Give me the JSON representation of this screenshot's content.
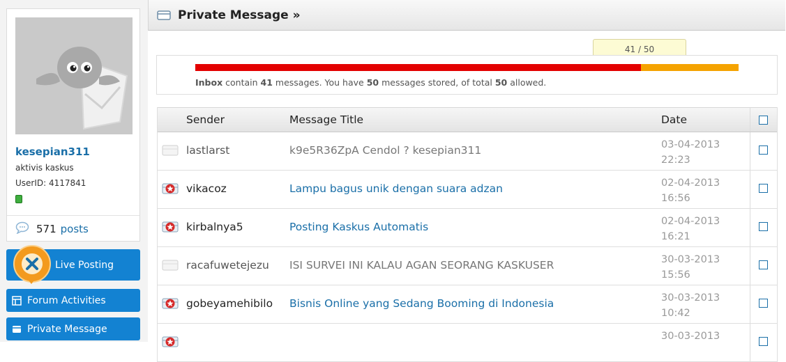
{
  "profile": {
    "username": "kesepian311",
    "title": "aktivis kaskus",
    "user_id": "UserID: 4117841",
    "post_count": "571",
    "post_label": "posts",
    "status": "online"
  },
  "sidebar": {
    "items": [
      {
        "label": "Live Posting",
        "icon": "live-posting-icon"
      },
      {
        "label": "Forum Activities",
        "icon": "forum-activities-icon"
      },
      {
        "label": "Private Message",
        "icon": "envelope-icon"
      }
    ]
  },
  "header": {
    "title": "Private Message »",
    "icon": "envelope-icon"
  },
  "quota": {
    "tooltip": "41 / 50",
    "used": 41,
    "total": 50,
    "text_folder": "Inbox",
    "text_1": " contain ",
    "inbox_count": "41",
    "text_2": " messages. You have ",
    "stored_count": "50",
    "text_3": " messages stored, of total ",
    "allowed_count": "50",
    "text_4": " allowed.",
    "used_color": "#e30000",
    "remaining_color": "#f5a300"
  },
  "table": {
    "headers": {
      "sender": "Sender",
      "title": "Message Title",
      "date": "Date"
    },
    "rows": [
      {
        "sender": "lastlarst",
        "title": "k9e5R36ZpA Cendol ? kesepian311",
        "date": "03-04-2013",
        "time": "22:23",
        "read": true
      },
      {
        "sender": "vikacoz",
        "title": "Lampu bagus unik dengan suara adzan",
        "date": "02-04-2013",
        "time": "16:56",
        "read": false
      },
      {
        "sender": "kirbalnya5",
        "title": "Posting Kaskus Automatis",
        "date": "02-04-2013",
        "time": "16:21",
        "read": false
      },
      {
        "sender": "racafuwetejezu",
        "title": "ISI SURVEI INI KALAU AGAN SEORANG KASKUSER",
        "date": "30-03-2013",
        "time": "15:56",
        "read": true
      },
      {
        "sender": "gobeyamehibilo",
        "title": "Bisnis Online yang Sedang Booming di Indonesia",
        "date": "30-03-2013",
        "time": "10:42",
        "read": false
      },
      {
        "sender": "",
        "title": "",
        "date": "30-03-2013",
        "time": "",
        "read": false
      }
    ]
  }
}
